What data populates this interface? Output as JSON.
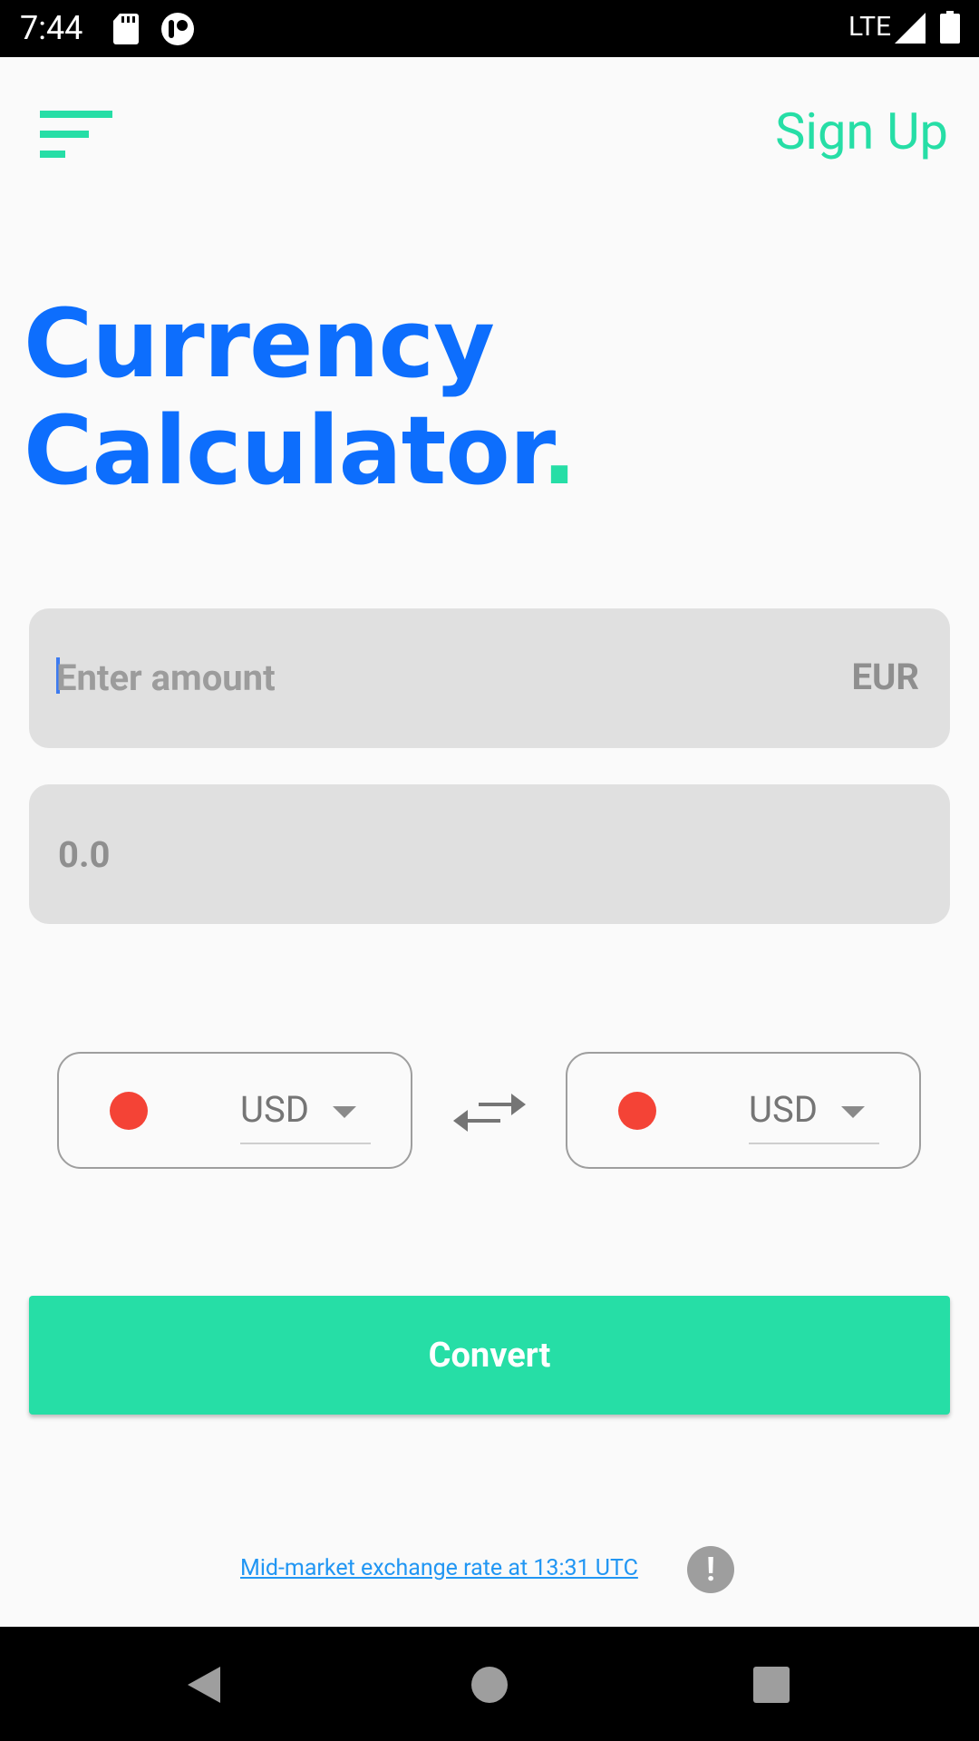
{
  "status_bar": {
    "time": "7:44",
    "network": "LTE",
    "icons": [
      "sd-card-icon",
      "circle-status-icon",
      "signal-icon",
      "battery-icon"
    ]
  },
  "header": {
    "menu_icon": "menu-icon",
    "sign_up_label": "Sign Up"
  },
  "title": {
    "line1": "Currency",
    "line2": "Calculator",
    "dot": "."
  },
  "amount_field": {
    "placeholder": "Enter amount",
    "value": "",
    "currency": "EUR"
  },
  "result_field": {
    "value": "0.0"
  },
  "from_currency": {
    "value": "USD",
    "flag_color": "#f44336"
  },
  "to_currency": {
    "value": "USD",
    "flag_color": "#f44336"
  },
  "swap_icon": "swap-arrows-icon",
  "convert_button": {
    "label": "Convert"
  },
  "footer": {
    "rate_text": "Mid-market exchange rate at 13:31 UTC",
    "info_icon": "!"
  },
  "colors": {
    "accent": "#26dea6",
    "title_blue": "#0d6efd",
    "link_blue": "#2196f3",
    "field_bg": "#e0e0e0"
  },
  "nav_bar": {
    "icons": [
      "back-icon",
      "home-icon",
      "recents-icon"
    ]
  }
}
